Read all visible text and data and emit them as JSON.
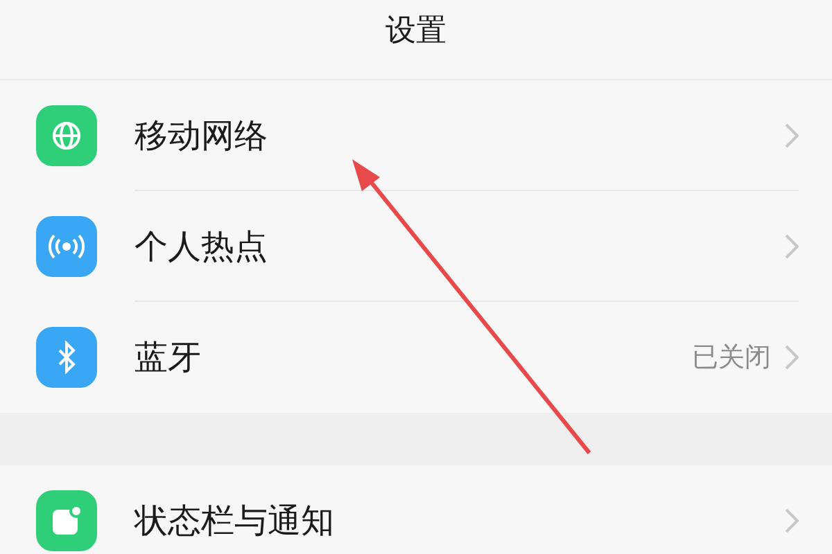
{
  "title": "设置",
  "groups": [
    {
      "items": [
        {
          "label": "移动网络",
          "kind": "network",
          "color": "#2fcf7a"
        },
        {
          "label": "个人热点",
          "kind": "hotspot",
          "color": "#3aa7f5"
        },
        {
          "label": "蓝牙",
          "kind": "bluetooth",
          "color": "#3aa7f5",
          "value": "已关闭"
        }
      ]
    },
    {
      "items": [
        {
          "label": "状态栏与通知",
          "kind": "notification",
          "color": "#2fcf7a"
        }
      ]
    }
  ]
}
